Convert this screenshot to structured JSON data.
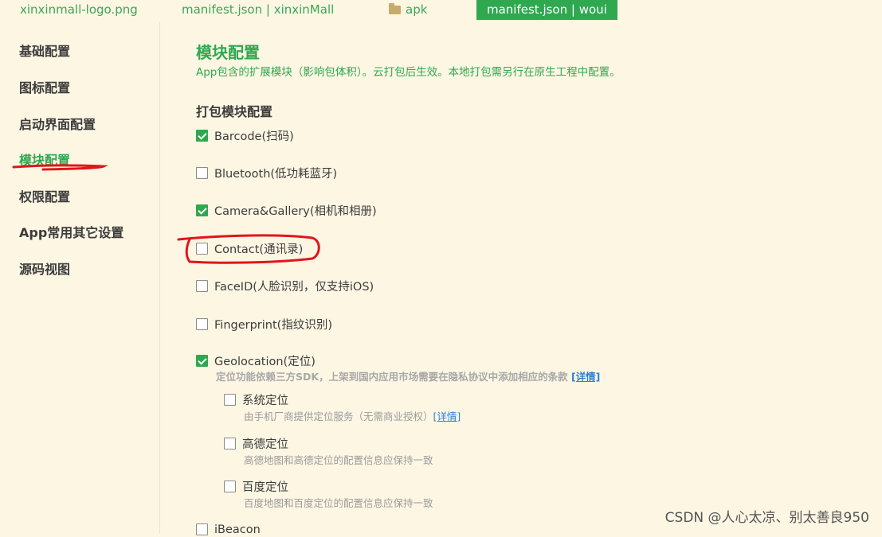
{
  "tabs": [
    {
      "label": "xinxinmall-logo.png"
    },
    {
      "label": "manifest.json | xinxinMall"
    },
    {
      "label": "apk"
    },
    {
      "label": "manifest.json | woui"
    }
  ],
  "sidebar": {
    "items": [
      {
        "label": "基础配置"
      },
      {
        "label": "图标配置"
      },
      {
        "label": "启动界面配置"
      },
      {
        "label": "模块配置"
      },
      {
        "label": "权限配置"
      },
      {
        "label": "App常用其它设置"
      },
      {
        "label": "源码视图"
      }
    ],
    "active_index": 3
  },
  "main": {
    "title": "模块配置",
    "description": "App包含的扩展模块（影响包体积）。云打包后生效。本地打包需另行在原生工程中配置。",
    "section_title": "打包模块配置",
    "modules": [
      {
        "label": "Barcode(扫码)",
        "checked": true
      },
      {
        "label": "Bluetooth(低功耗蓝牙)",
        "checked": false
      },
      {
        "label": "Camera&Gallery(相机和相册)",
        "checked": true
      },
      {
        "label": "Contact(通讯录)",
        "checked": false
      },
      {
        "label": "FaceID(人脸识别，仅支持iOS)",
        "checked": false
      },
      {
        "label": "Fingerprint(指纹识别)",
        "checked": false
      },
      {
        "label": "Geolocation(定位)",
        "checked": true
      },
      {
        "label": "iBeacon",
        "checked": false
      }
    ],
    "geolocation_note": "定位功能依赖三方SDK，上架到国内应用市场需要在隐私协议中添加相应的条款",
    "details_link": "[详情]",
    "sub_modules": [
      {
        "label": "系统定位",
        "checked": false,
        "note": "由手机厂商提供定位服务（无需商业授权）"
      },
      {
        "label": "高德定位",
        "checked": false,
        "note": "高德地图和高德定位的配置信息应保持一致"
      },
      {
        "label": "百度定位",
        "checked": false,
        "note": "百度地图和百度定位的配置信息应保持一致"
      }
    ]
  },
  "watermark": "CSDN @人心太凉、别太善良950",
  "colors": {
    "accent": "#2fa84f",
    "background": "#fdf6e3",
    "annotation": "#e0161b",
    "link": "#2f7fd6"
  }
}
